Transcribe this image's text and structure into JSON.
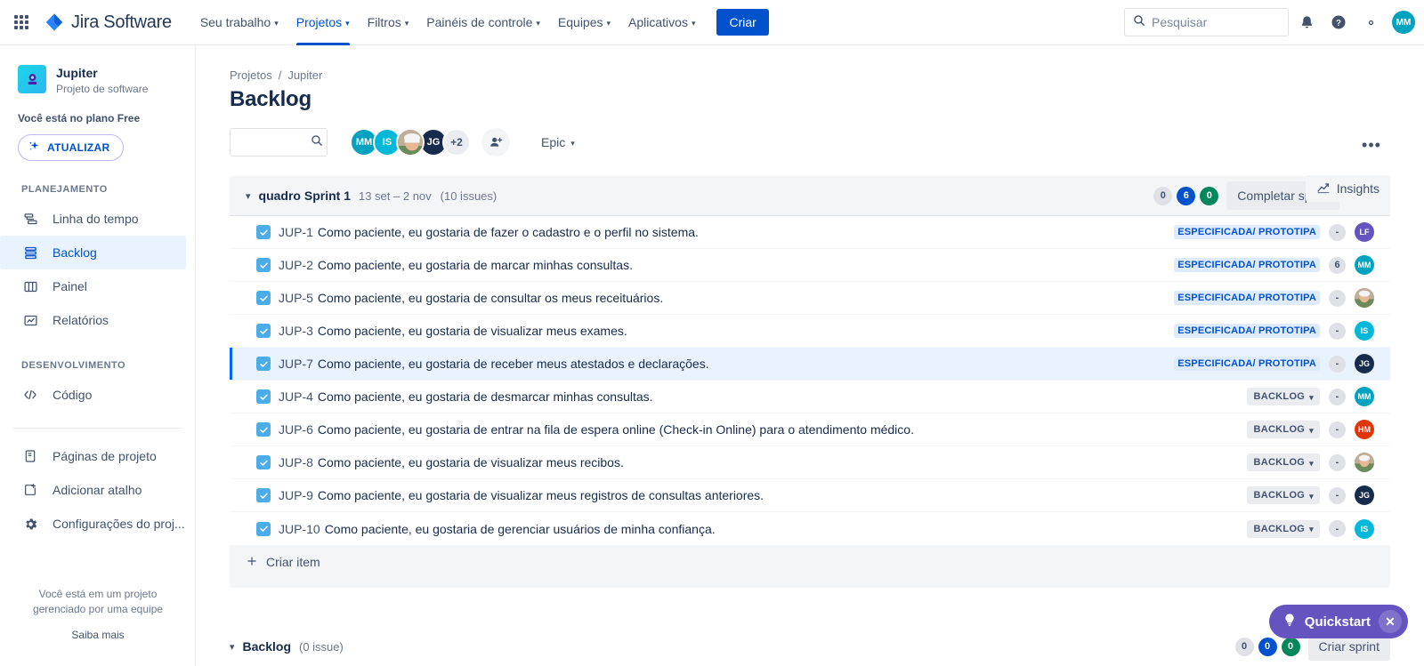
{
  "topnav": {
    "app_switcher_icon": "grid-apps-icon",
    "brand": "Jira Software",
    "items": [
      {
        "label": "Seu trabalho",
        "has_caret": true,
        "active": false
      },
      {
        "label": "Projetos",
        "has_caret": true,
        "active": true
      },
      {
        "label": "Filtros",
        "has_caret": true,
        "active": false
      },
      {
        "label": "Painéis de controle",
        "has_caret": true,
        "active": false
      },
      {
        "label": "Equipes",
        "has_caret": true,
        "active": false
      },
      {
        "label": "Aplicativos",
        "has_caret": true,
        "active": false
      }
    ],
    "create_label": "Criar",
    "search_placeholder": "Pesquisar",
    "search_value": "",
    "notifications_icon": "bell-icon",
    "help_icon": "help-circle-icon",
    "settings_icon": "gear-icon",
    "user_initials": "MM",
    "user_avatar_color": "#00A3BF"
  },
  "sidebar": {
    "project_name": "Jupiter",
    "project_type": "Projeto de software",
    "plan_text": "Você está no plano Free",
    "upgrade_label": "ATUALIZAR",
    "sections": [
      {
        "label": "PLANEJAMENTO",
        "items": [
          {
            "label": "Linha do tempo",
            "icon": "timeline-icon",
            "selected": false
          },
          {
            "label": "Backlog",
            "icon": "backlog-icon",
            "selected": true
          },
          {
            "label": "Painel",
            "icon": "board-columns-icon",
            "selected": false
          },
          {
            "label": "Relatórios",
            "icon": "reports-chart-icon",
            "selected": false
          }
        ]
      },
      {
        "label": "DESENVOLVIMENTO",
        "items": [
          {
            "label": "Código",
            "icon": "code-brackets-icon",
            "selected": false
          }
        ]
      }
    ],
    "extra_items": [
      {
        "label": "Páginas de projeto",
        "icon": "page-document-icon"
      },
      {
        "label": "Adicionar atalho",
        "icon": "add-shortcut-icon"
      },
      {
        "label": "Configurações do proj...",
        "icon": "gear-icon"
      }
    ],
    "footer_text": "Você está em um projeto gerenciado por uma equipe",
    "footer_link": "Saiba mais"
  },
  "header": {
    "breadcrumb": [
      "Projetos",
      "Jupiter"
    ],
    "breadcrumb_separator": "/",
    "title": "Backlog",
    "more_icon": "more-horizontal-icon",
    "insights_label": "Insights",
    "insights_icon": "insights-chart-icon"
  },
  "toolbar": {
    "search_placeholder": "",
    "search_value": "",
    "search_icon": "search-icon",
    "avatars": [
      {
        "initials": "MM",
        "color": "#00A3BF",
        "photo": false
      },
      {
        "initials": "IS",
        "color": "#00B8D9",
        "photo": false
      },
      {
        "initials": "",
        "color": "#A3907C",
        "photo": true
      },
      {
        "initials": "JG",
        "color": "#172B4D",
        "photo": false
      }
    ],
    "avatar_overflow": "+2",
    "add_people_icon": "add-person-icon",
    "epic_label": "Epic"
  },
  "sprint": {
    "expanded": true,
    "name": "quadro Sprint 1",
    "dates": "13 set – 2 nov",
    "issue_count": "(10 issues)",
    "pills": [
      {
        "value": "0",
        "color": "#DFE1E6",
        "style": "grey"
      },
      {
        "value": "6",
        "color": "#0052CC",
        "style": "blue"
      },
      {
        "value": "0",
        "color": "#00875A",
        "style": "green"
      }
    ],
    "complete_label": "Completar sprint",
    "more_icon": "more-horizontal-icon",
    "create_item_label": "Criar item",
    "create_item_icon": "plus-icon",
    "issues": [
      {
        "key": "JUP-1",
        "summary": "Como paciente, eu gostaria de fazer o cadastro e o perfil no sistema.",
        "status": "ESPECIFICADA/ PROTOTIPA",
        "status_style": "plain",
        "estimate": "-",
        "avatar_initials": "LF",
        "avatar_color": "#6554C0",
        "avatar_photo": false,
        "selected": false
      },
      {
        "key": "JUP-2",
        "summary": "Como paciente, eu gostaria de marcar minhas consultas.",
        "status": "ESPECIFICADA/ PROTOTIPA",
        "status_style": "plain",
        "estimate": "6",
        "avatar_initials": "MM",
        "avatar_color": "#00A3BF",
        "avatar_photo": false,
        "selected": false
      },
      {
        "key": "JUP-5",
        "summary": "Como paciente, eu gostaria de consultar os meus receituários.",
        "status": "ESPECIFICADA/ PROTOTIPA",
        "status_style": "plain",
        "estimate": "-",
        "avatar_initials": "",
        "avatar_color": "#A3907C",
        "avatar_photo": true,
        "selected": false
      },
      {
        "key": "JUP-3",
        "summary": "Como paciente, eu gostaria de visualizar meus exames.",
        "status": "ESPECIFICADA/ PROTOTIPA",
        "status_style": "plain",
        "estimate": "-",
        "avatar_initials": "IS",
        "avatar_color": "#00B8D9",
        "avatar_photo": false,
        "selected": false
      },
      {
        "key": "JUP-7",
        "summary": "Como paciente, eu gostaria de receber meus atestados e declarações.",
        "status": "ESPECIFICADA/ PROTOTIPA",
        "status_style": "plain",
        "estimate": "-",
        "avatar_initials": "JG",
        "avatar_color": "#172B4D",
        "avatar_photo": false,
        "selected": true
      },
      {
        "key": "JUP-4",
        "summary": "Como paciente, eu gostaria de desmarcar minhas consultas.",
        "status": "BACKLOG",
        "status_style": "dropdown",
        "estimate": "-",
        "avatar_initials": "MM",
        "avatar_color": "#00A3BF",
        "avatar_photo": false,
        "selected": false
      },
      {
        "key": "JUP-6",
        "summary": "Como paciente, eu gostaria de entrar na fila de espera online (Check-in Online) para o atendimento médico.",
        "status": "BACKLOG",
        "status_style": "dropdown",
        "estimate": "-",
        "avatar_initials": "HM",
        "avatar_color": "#DE350B",
        "avatar_photo": false,
        "selected": false
      },
      {
        "key": "JUP-8",
        "summary": "Como paciente, eu gostaria de visualizar meus recibos.",
        "status": "BACKLOG",
        "status_style": "dropdown",
        "estimate": "-",
        "avatar_initials": "",
        "avatar_color": "#A3907C",
        "avatar_photo": true,
        "selected": false
      },
      {
        "key": "JUP-9",
        "summary": "Como paciente, eu gostaria de visualizar meus registros de consultas anteriores.",
        "status": "BACKLOG",
        "status_style": "dropdown",
        "estimate": "-",
        "avatar_initials": "JG",
        "avatar_color": "#172B4D",
        "avatar_photo": false,
        "selected": false
      },
      {
        "key": "JUP-10",
        "summary": "Como paciente, eu gostaria de gerenciar usuários de minha confiança.",
        "status": "BACKLOG",
        "status_style": "dropdown",
        "estimate": "-",
        "avatar_initials": "IS",
        "avatar_color": "#00B8D9",
        "avatar_photo": false,
        "selected": false
      }
    ]
  },
  "backlog_section": {
    "expanded": true,
    "name": "Backlog",
    "issue_count": "(0 issue)",
    "pills": [
      {
        "value": "0",
        "style": "grey"
      },
      {
        "value": "0",
        "style": "blue"
      },
      {
        "value": "0",
        "style": "green"
      }
    ],
    "create_sprint_label": "Criar sprint"
  },
  "quickstart": {
    "label": "Quickstart",
    "icon": "lightbulb-icon",
    "close_icon": "close-icon",
    "color": "#6554C0"
  }
}
